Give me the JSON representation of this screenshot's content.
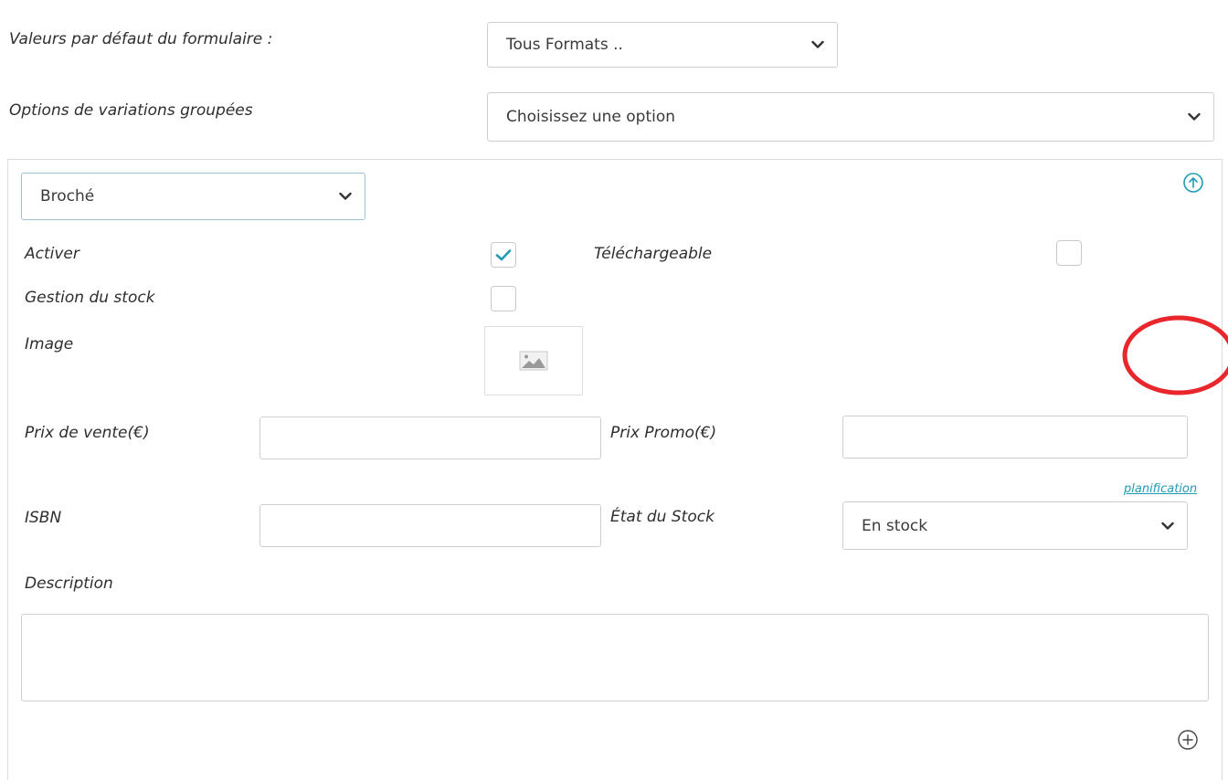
{
  "form_defaults": {
    "label": "Valeurs par défaut du formulaire :",
    "selected": "Tous Formats .."
  },
  "grouped_variations": {
    "label": "Options de variations groupées",
    "selected": "Choisissez une option"
  },
  "variation": {
    "format_selected": "Broché",
    "activer": {
      "label": "Activer",
      "checked": true
    },
    "telechargeable": {
      "label": "Téléchargeable",
      "checked": false
    },
    "gestion_stock": {
      "label": "Gestion du stock",
      "checked": false
    },
    "image": {
      "label": "Image"
    },
    "prix_vente": {
      "label": "Prix de vente(€)",
      "value": ""
    },
    "prix_promo": {
      "label": "Prix Promo(€)",
      "value": ""
    },
    "planification_link": "planification",
    "isbn": {
      "label": "ISBN",
      "value": ""
    },
    "etat_stock": {
      "label": "État du Stock",
      "selected": "En stock"
    },
    "description": {
      "label": "Description",
      "value": ""
    }
  },
  "icons": {
    "collapse": "arrow-up-circle-icon",
    "add": "plus-circle-icon",
    "chevron": "chevron-down-icon",
    "image": "image-placeholder-icon"
  },
  "colors": {
    "accent": "#1e9bb6",
    "annotation": "#e8262c"
  }
}
